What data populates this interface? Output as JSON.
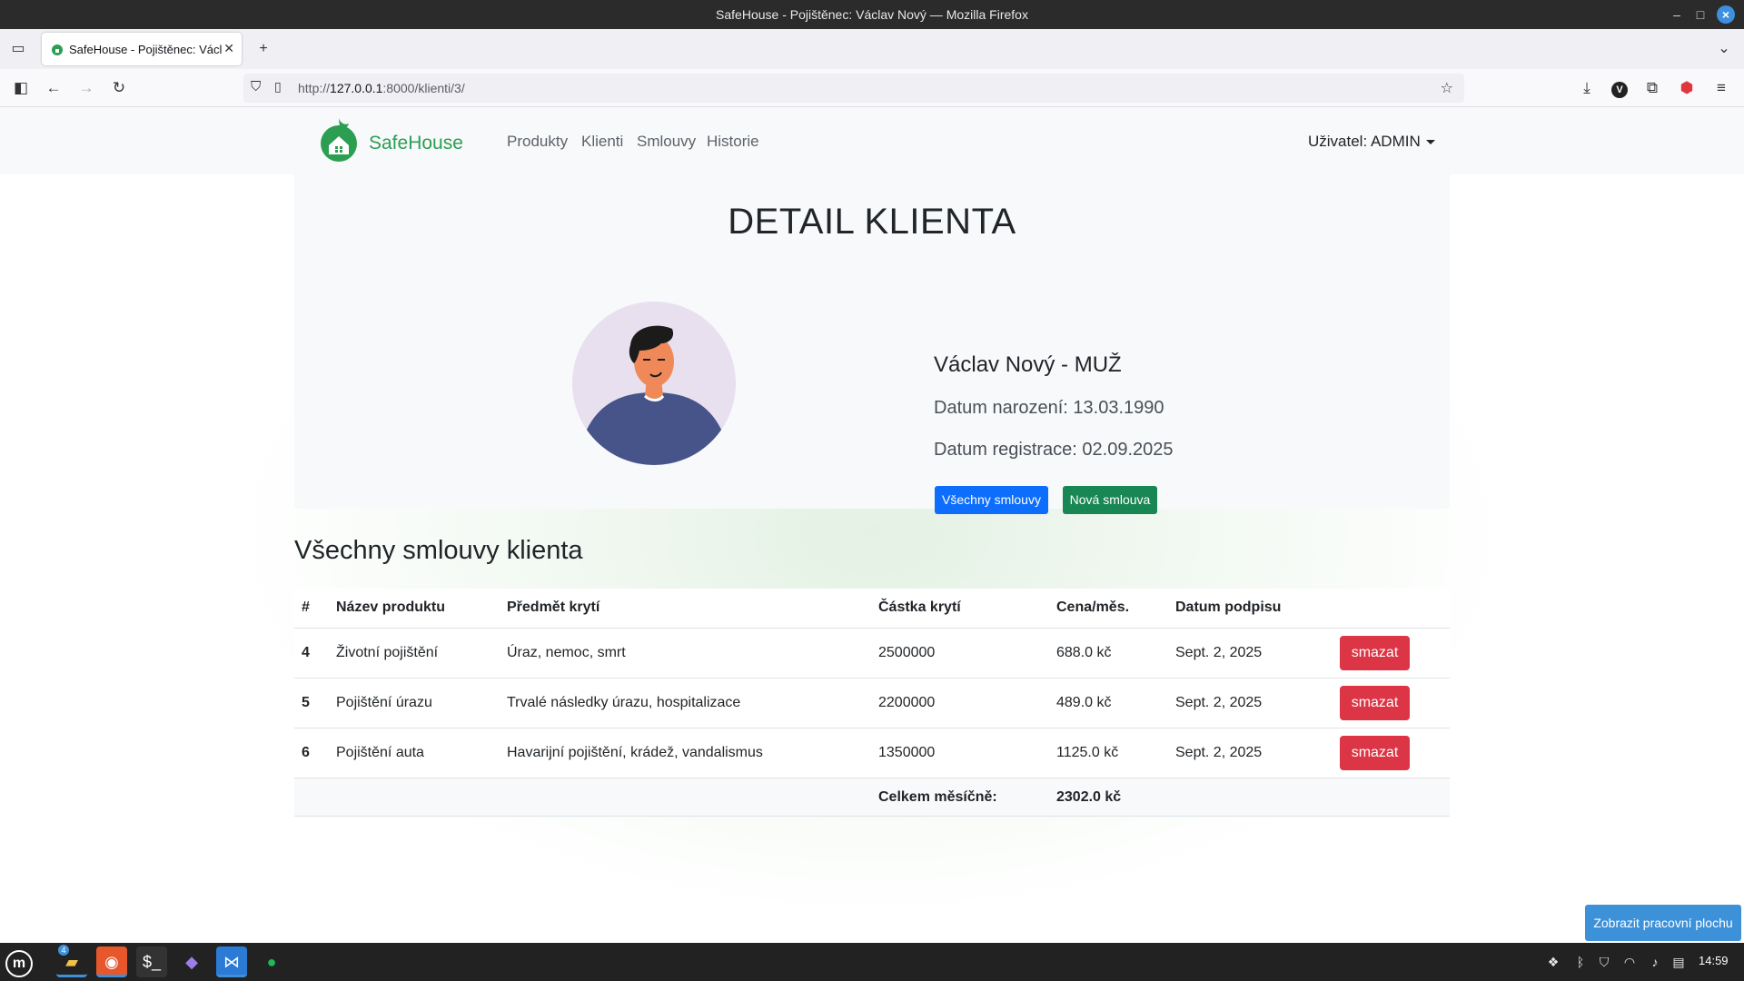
{
  "window": {
    "title": "SafeHouse - Pojištěnec: Václav Nový — Mozilla Firefox"
  },
  "browser": {
    "tab_title": "SafeHouse - Pojištěnec: Václav Nový",
    "url_prefix": "http://",
    "url_host": "127.0.0.1",
    "url_rest": ":8000/klienti/3/"
  },
  "site": {
    "brand": "SafeHouse",
    "nav": [
      "Produkty",
      "Klienti",
      "Smlouvy",
      "Historie"
    ],
    "user": "Uživatel: ADMIN"
  },
  "detail": {
    "heading": "DETAIL KLIENTA",
    "name_line": "Václav Nový - MUŽ",
    "birth": "Datum narození: 13.03.1990",
    "registered": "Datum registrace: 02.09.2025",
    "btn_all": "Všechny smlouvy",
    "btn_new": "Nová smlouva"
  },
  "contracts": {
    "heading": "Všechny smlouvy klienta",
    "columns": [
      "#",
      "Název produktu",
      "Předmět krytí",
      "Částka krytí",
      "Cena/měs.",
      "Datum podpisu"
    ],
    "rows": [
      {
        "id": "4",
        "product": "Životní pojištění",
        "coverage": "Úraz, nemoc, smrt",
        "amount": "2500000",
        "price": "688.0 kč",
        "date": "Sept. 2, 2025",
        "action": "smazat"
      },
      {
        "id": "5",
        "product": "Pojištění úrazu",
        "coverage": "Trvalé následky úrazu, hospitalizace",
        "amount": "2200000",
        "price": "489.0 kč",
        "date": "Sept. 2, 2025",
        "action": "smazat"
      },
      {
        "id": "6",
        "product": "Pojištění auta",
        "coverage": "Havarijní pojištění, krádež, vandalismus",
        "amount": "1350000",
        "price": "1125.0 kč",
        "date": "Sept. 2, 2025",
        "action": "smazat"
      }
    ],
    "total_label": "Celkem měsíčně:",
    "total_value": "2302.0 kč"
  },
  "desktop": {
    "show_desktop": "Zobrazit pracovní plochu",
    "clock": "14:59",
    "files_badge": "4"
  },
  "colors": {
    "brand": "#2c9e52",
    "primary": "#0d6efd",
    "success": "#198754",
    "danger": "#dc3545"
  }
}
